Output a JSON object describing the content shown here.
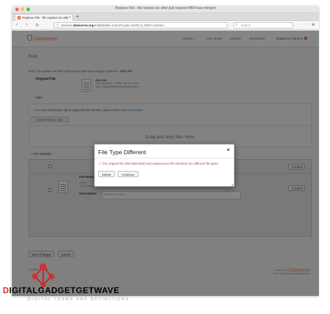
{
  "window": {
    "title": "Replace File - file replace tsv after pull request 4854 was merged",
    "traffic_lights": [
      "#fc605c",
      "#fdbc40",
      "#34c84a"
    ]
  },
  "browser": {
    "tab_label": "Replace File - file replace tsv afte",
    "tab_close": "×",
    "new_tab": "+",
    "back": "‹",
    "forward": "›",
    "reload": "↻",
    "url_prefix": "phoenix.",
    "url_domain": "dataverse.org",
    "url_rest": "/editdatafiles.xhtml?mode=SINGLE_REPLACE&d=...",
    "search_placeholder": "Search",
    "menu": "≡"
  },
  "header": {
    "brand": "Dataverse",
    "search": "Search ▾",
    "user_guide": "User Guide",
    "support": "Support",
    "dashboard": "Dashboard",
    "user": "Dataverse Admin ▾",
    "badge": "2"
  },
  "page": {
    "root_link": "Root",
    "breadcrumb": {
      "root": "Root",
      "sep": " › ",
      "dataset": "file replace tsv after pull request 4854 was merged",
      "file": "data.tsv",
      "current": "Edit Files"
    },
    "original_file_label": "Original File",
    "original_file": {
      "name": "data.tab",
      "meta1": "Tab-Delimited - 13 KB - Jun 14, 2018",
      "meta2": "MD5: 2a5b3b3f9f5b3ba2e5d52c0d5..."
    },
    "files_label": "Files",
    "files_info_pre": "For more information about supported file formats, please refer to the ",
    "files_info_link": "User Guide",
    "files_info_post": ".",
    "select_files_button": "+ Select Files to Add",
    "dropzone_text": "Drag and drop files here.",
    "selected_count": "1 File Selected",
    "edit_button": "✎ Edit ▾",
    "file_name_label": "File Name",
    "file_name_value": "data.txt",
    "file_meta1": "text/tsv",
    "file_meta2": "MD5: 2a5b3b3f9f5b3...",
    "description_label": "Description",
    "description_placeholder": "Add file description...",
    "save_button": "Save Changes",
    "cancel_button": "Cancel",
    "footer_left": "Copyright © 2018",
    "footer_powered": "Powered by",
    "footer_brand": "Dataverse",
    "footer_version": "v. 4.9.1 build 554-phoenix-dataverse"
  },
  "modal": {
    "title": "File Type Different",
    "close": "×",
    "message": "The original file (Tab-Delimited) and replacement file (text/tsv) are different file types.",
    "warn_icon": "⚠",
    "delete_button": "Delete",
    "continue_button": "Continue",
    "resize": "◢"
  },
  "watermark": {
    "part1": "D",
    "part2": "IGITAL",
    "part3": "GADGET",
    "part4": "GETWAVE",
    "sub": "DIGITAL TERMS AND DEFINITIONS"
  }
}
